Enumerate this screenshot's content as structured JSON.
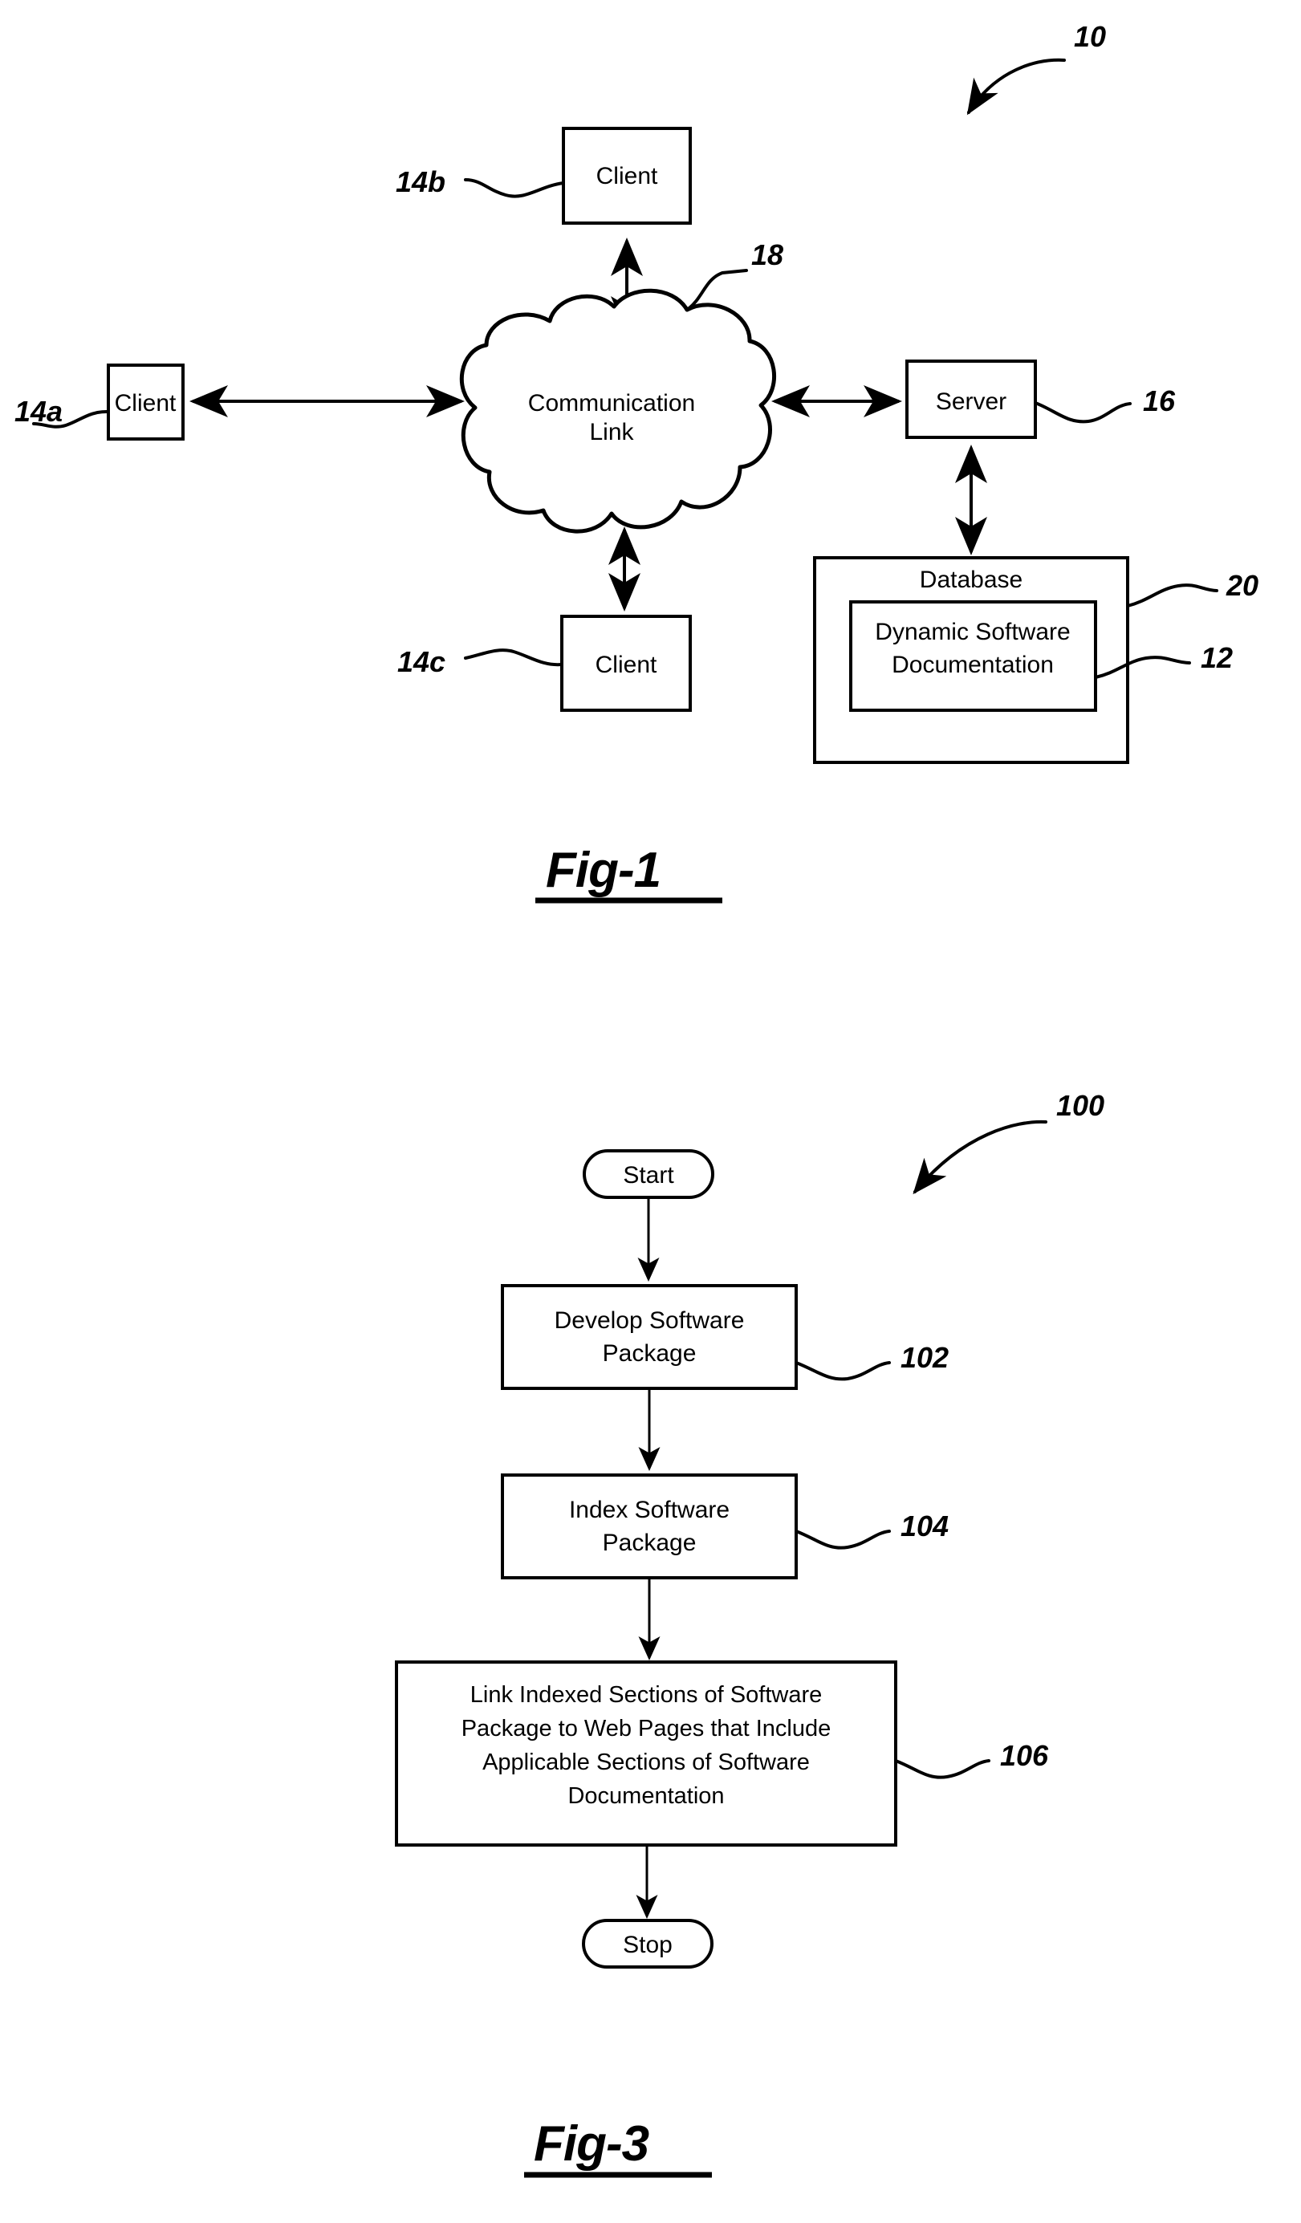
{
  "sheet": {
    "background_color": "#ffffff",
    "ink_color": "#000000"
  },
  "figures": [
    {
      "id": "fig-1",
      "caption": "Fig-1",
      "system_ref": "10",
      "nodes": [
        {
          "key": "client_b",
          "label": "Client",
          "ref": "14b"
        },
        {
          "key": "client_a",
          "label": "Client",
          "ref": "14a"
        },
        {
          "key": "client_c",
          "label": "Client",
          "ref": "14c"
        },
        {
          "key": "cloud",
          "label_line1": "Communication",
          "label_line2": "Link",
          "ref": "18"
        },
        {
          "key": "server",
          "label": "Server",
          "ref": "16"
        },
        {
          "key": "database",
          "label": "Database",
          "ref": "20"
        },
        {
          "key": "dynamic_doc",
          "label_line1": "Dynamic Software",
          "label_line2": "Documentation",
          "ref": "12"
        }
      ]
    },
    {
      "id": "fig-3",
      "caption": "Fig-3",
      "system_ref": "100",
      "nodes": [
        {
          "key": "start",
          "label": "Start",
          "ref": ""
        },
        {
          "key": "step_102",
          "label_line1": "Develop Software",
          "label_line2": "Package",
          "ref": "102"
        },
        {
          "key": "step_104",
          "label_line1": "Index Software",
          "label_line2": "Package",
          "ref": "104"
        },
        {
          "key": "step_106",
          "label_line1": "Link Indexed Sections of Software",
          "label_line2": "Package to Web Pages that Include",
          "label_line3": "Applicable Sections of Software",
          "label_line4": "Documentation",
          "ref": "106"
        },
        {
          "key": "stop",
          "label": "Stop",
          "ref": ""
        }
      ]
    }
  ],
  "fig1": {
    "caption": "Fig-1",
    "ref_system": "10",
    "client_b_label": "Client",
    "client_b_ref": "14b",
    "client_a_label": "Client",
    "client_a_ref": "14a",
    "client_c_label": "Client",
    "client_c_ref": "14c",
    "cloud_label_1": "Communication",
    "cloud_label_2": "Link",
    "cloud_ref": "18",
    "server_label": "Server",
    "server_ref": "16",
    "database_label": "Database",
    "database_ref": "20",
    "doc_label_1": "Dynamic Software",
    "doc_label_2": "Documentation",
    "doc_ref": "12"
  },
  "fig3": {
    "caption": "Fig-3",
    "ref_method": "100",
    "start_label": "Start",
    "step102_line1": "Develop Software",
    "step102_line2": "Package",
    "step102_ref": "102",
    "step104_line1": "Index Software",
    "step104_line2": "Package",
    "step104_ref": "104",
    "step106_line1": "Link Indexed Sections of Software",
    "step106_line2": "Package to Web Pages that Include",
    "step106_line3": "Applicable Sections of Software",
    "step106_line4": "Documentation",
    "step106_ref": "106",
    "stop_label": "Stop"
  }
}
